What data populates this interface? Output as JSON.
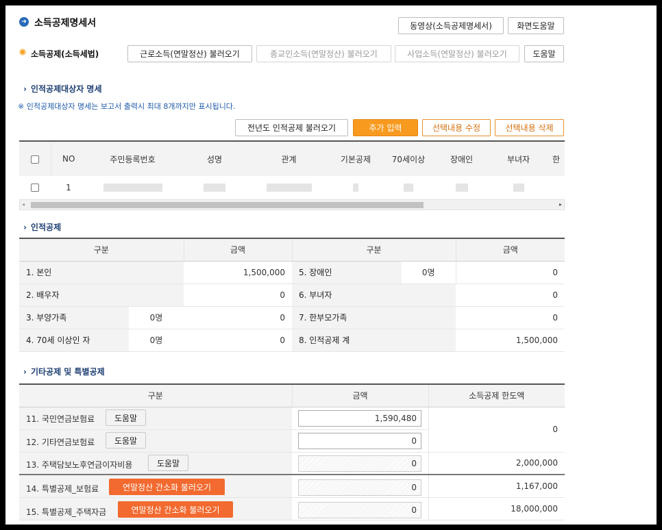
{
  "page": {
    "title": "소득공제명세서",
    "video_button": "동영상(소득공제명세서)",
    "help_button": "화면도움말"
  },
  "import_bar": {
    "label": "소득공제(소득세법)",
    "buttons": [
      "근로소득(연말정산) 불러오기",
      "종교인소득(연말정산) 불러오기",
      "사업소득(연말정산) 불러오기",
      "도움말"
    ]
  },
  "dependents": {
    "title": "인적공제대상자 명세",
    "note": "※ 인적공제대상자 명세는 보고서 출력시 최대 8개까지만 표시됩니다.",
    "actions": [
      "전년도 인적공제 불러오기",
      "추가 입력",
      "선택내용 수정",
      "선택내용 삭제"
    ],
    "columns": [
      "NO",
      "주민등록번호",
      "성명",
      "관계",
      "기본공제",
      "70세이상",
      "장애인",
      "부녀자",
      "한"
    ],
    "rows": [
      {
        "no": "1"
      }
    ]
  },
  "personal": {
    "title": "인적공제",
    "headers": [
      "구분",
      "금액",
      "구분",
      "금액"
    ],
    "left": [
      {
        "label": "1. 본인",
        "count": "",
        "amount": "1,500,000"
      },
      {
        "label": "2. 배우자",
        "count": "",
        "amount": "0"
      },
      {
        "label": "3. 부양가족",
        "count": "0명",
        "amount": "0"
      },
      {
        "label": "4. 70세 이상인 자",
        "count": "0명",
        "amount": "0"
      }
    ],
    "right": [
      {
        "label": "5. 장애인",
        "count": "0명",
        "amount": "0"
      },
      {
        "label": "6. 부녀자",
        "count": "",
        "amount": "0"
      },
      {
        "label": "7. 한부모가족",
        "count": "",
        "amount": "0"
      },
      {
        "label": "8. 인적공제 계",
        "count": "",
        "amount": "1,500,000"
      }
    ]
  },
  "other": {
    "title": "기타공제 및 특별공제",
    "headers": [
      "구분",
      "금액",
      "소득공제 한도액"
    ],
    "rows": [
      {
        "label": "11. 국민연금보험료",
        "button": "도움말",
        "amount": "1,590,480",
        "limit": "0"
      },
      {
        "label": "12. 기타연금보험료",
        "button": "도움말",
        "amount": "0",
        "limit": ""
      },
      {
        "label": "13. 주택담보노후연금이자비용",
        "button": "도움말",
        "amount": "0",
        "limit": "2,000,000"
      },
      {
        "label": "14. 특별공제_보험료",
        "button": "연말정산 간소화 불러오기",
        "amount": "0",
        "limit": "1,167,000"
      },
      {
        "label": "15. 특별공제_주택자금",
        "button": "연말정산 간소화 불러오기",
        "amount": "0",
        "limit": "18,000,000"
      }
    ]
  },
  "colors": {
    "accent_blue": "#1e3f73",
    "orange": "#f79a1f",
    "red_button": "#f26a2f"
  }
}
